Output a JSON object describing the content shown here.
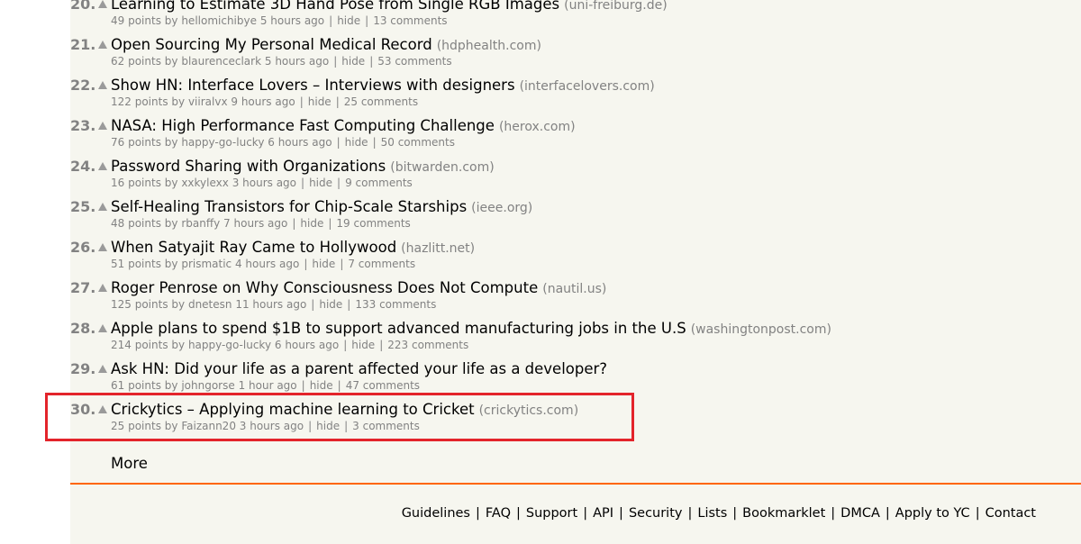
{
  "stories": [
    {
      "rank": "20.",
      "title": "Learning to Estimate 3D Hand Pose from Single RGB Images",
      "site": "(uni-freiburg.de)",
      "points": "49 points",
      "user": "hellomichibye",
      "age": "5 hours ago",
      "hide": "hide",
      "comments": "13 comments"
    },
    {
      "rank": "21.",
      "title": "Open Sourcing My Personal Medical Record",
      "site": "(hdphealth.com)",
      "points": "62 points",
      "user": "blaurenceclark",
      "age": "5 hours ago",
      "hide": "hide",
      "comments": "53 comments"
    },
    {
      "rank": "22.",
      "title": "Show HN: Interface Lovers – Interviews with designers",
      "site": "(interfacelovers.com)",
      "points": "122 points",
      "user": "viiralvx",
      "age": "9 hours ago",
      "hide": "hide",
      "comments": "25 comments"
    },
    {
      "rank": "23.",
      "title": "NASA: High Performance Fast Computing Challenge",
      "site": "(herox.com)",
      "points": "76 points",
      "user": "happy-go-lucky",
      "age": "6 hours ago",
      "hide": "hide",
      "comments": "50 comments"
    },
    {
      "rank": "24.",
      "title": "Password Sharing with Organizations",
      "site": "(bitwarden.com)",
      "points": "16 points",
      "user": "xxkylexx",
      "age": "3 hours ago",
      "hide": "hide",
      "comments": "9 comments"
    },
    {
      "rank": "25.",
      "title": "Self-Healing Transistors for Chip-Scale Starships",
      "site": "(ieee.org)",
      "points": "48 points",
      "user": "rbanffy",
      "age": "7 hours ago",
      "hide": "hide",
      "comments": "19 comments"
    },
    {
      "rank": "26.",
      "title": "When Satyajit Ray Came to Hollywood",
      "site": "(hazlitt.net)",
      "points": "51 points",
      "user": "prismatic",
      "age": "4 hours ago",
      "hide": "hide",
      "comments": "7 comments"
    },
    {
      "rank": "27.",
      "title": "Roger Penrose on Why Consciousness Does Not Compute",
      "site": "(nautil.us)",
      "points": "125 points",
      "user": "dnetesn",
      "age": "11 hours ago",
      "hide": "hide",
      "comments": "133 comments"
    },
    {
      "rank": "28.",
      "title": "Apple plans to spend $1B to support advanced manufacturing jobs in the U.S",
      "site": "(washingtonpost.com)",
      "points": "214 points",
      "user": "happy-go-lucky",
      "age": "6 hours ago",
      "hide": "hide",
      "comments": "223 comments"
    },
    {
      "rank": "29.",
      "title": "Ask HN: Did your life as a parent affected your life as a developer?",
      "site": "",
      "points": "61 points",
      "user": "johngorse",
      "age": "1 hour ago",
      "hide": "hide",
      "comments": "47 comments"
    },
    {
      "rank": "30.",
      "title": "Crickytics – Applying machine learning to Cricket",
      "site": "(crickytics.com)",
      "points": "25 points",
      "user": "Faizann20",
      "age": "3 hours ago",
      "hide": "hide",
      "comments": "3 comments"
    }
  ],
  "labels": {
    "by": "by",
    "pipe": "|"
  },
  "more": "More",
  "footer": [
    "Guidelines",
    "FAQ",
    "Support",
    "API",
    "Security",
    "Lists",
    "Bookmarklet",
    "DMCA",
    "Apply to YC",
    "Contact"
  ],
  "colors": {
    "background": "#f6f6ef",
    "accent": "#ff6600",
    "muted": "#828282",
    "highlight": "#e3242b"
  },
  "icons": {
    "vote": "upvote-arrow-icon"
  }
}
